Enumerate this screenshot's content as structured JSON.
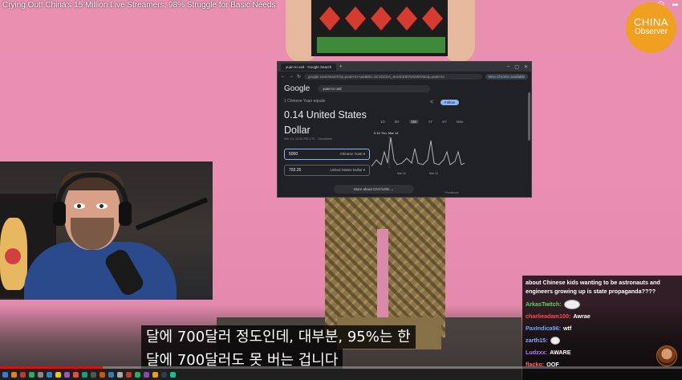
{
  "video": {
    "title": "Crying Out! China's 15 Million Live Streamers, 98% Struggle for Basic Needs",
    "top_icons": [
      "watch-later-icon",
      "share-icon"
    ],
    "progress_fraction": 0.15
  },
  "logo": {
    "line1": "CHINA",
    "line2": "Observer"
  },
  "browser": {
    "tab_label": "yuan to usd",
    "tab2_label": "Google Search",
    "url": "google.com/search?q=yuan+to+usd&rlz=1C1GCEA_enUS1007US1007&oq=yuan+to",
    "extension_label": "New Chrome available",
    "search_query": "yuan to usd",
    "equals_text": "1 Chinese Yuan equals",
    "result_text": "0.14 United States Dollar",
    "date_text": "Mar 14, 10:52 PM UTC · Disclaimer",
    "from_value": "5000",
    "from_unit": "Chinese Yuan",
    "to_value": "703.25",
    "to_unit": "United States Dollar",
    "follow_label": "Follow",
    "ranges": [
      "1D",
      "5D",
      "1M",
      "1Y",
      "5Y",
      "Max"
    ],
    "active_range": "1M",
    "chart_tooltip": "0.14  Thu, Mar 14",
    "chart_xlabels": [
      "Mar 10",
      "Mar 12"
    ],
    "more_label": "More about CNY/USD  →",
    "feedback": "Feedback"
  },
  "chat": {
    "first_message": "about Chinese kids wanting to be astronauts and engineers growing up is state propaganda????",
    "messages": [
      {
        "user": "ArkasTwitch:",
        "color": "#5fd35f",
        "text": "",
        "emote": "trollface"
      },
      {
        "user": "charlieadam100:",
        "color": "#ff4d4d",
        "text": "Awrae",
        "emote": ""
      },
      {
        "user": "PaxIndica96:",
        "color": "#6fa8ff",
        "text": "wtf",
        "emote": ""
      },
      {
        "user": "zarth15:",
        "color": "#8fa8ff",
        "text": "",
        "emote": "trollface-small"
      },
      {
        "user": "Ludzxx:",
        "color": "#b47cff",
        "text": "AWARE",
        "emote": ""
      },
      {
        "user": "flacko:",
        "color": "#ff6b6b",
        "text": "OOF",
        "emote": ""
      }
    ]
  },
  "subtitle": {
    "line1": "달에 700달러 정도인데, 대부분, 95%는 한",
    "line2": "달에 700달러도 못 버는 겁니다"
  }
}
